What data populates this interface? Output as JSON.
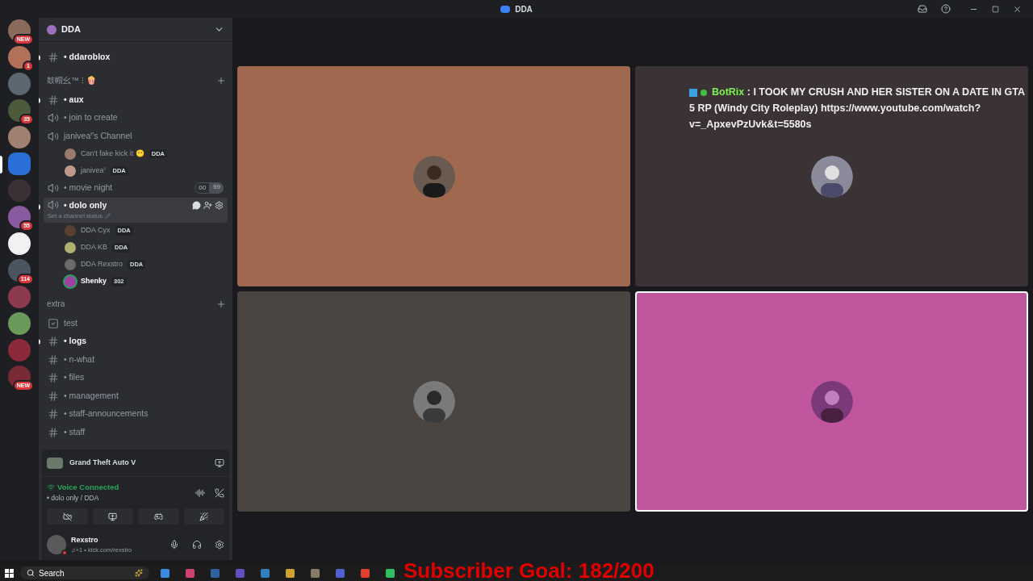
{
  "window": {
    "title": "DDA"
  },
  "servers": [
    {
      "kind": "avatar",
      "color": "#8a6a5a",
      "badge": "NEW",
      "selected": false
    },
    {
      "kind": "avatar",
      "color": "#b4715a",
      "badge": "1",
      "selected": false
    },
    {
      "kind": "avatar",
      "color": "#5a6670",
      "selected": false
    },
    {
      "kind": "avatar",
      "color": "#4a5a3a",
      "badge": "35",
      "selected": false
    },
    {
      "kind": "avatar",
      "color": "#a08070",
      "selected": false
    },
    {
      "kind": "avatar",
      "color": "#2a6fd6",
      "selected": true
    },
    {
      "kind": "avatar",
      "color": "#3a3035",
      "selected": false
    },
    {
      "kind": "avatar",
      "color": "#8a5aa0",
      "badge": "55",
      "selected": false
    },
    {
      "kind": "avatar",
      "color": "#f2f2f2",
      "selected": false
    },
    {
      "kind": "avatar",
      "color": "#4a5560",
      "badge": "114",
      "selected": false
    },
    {
      "kind": "avatar",
      "color": "#8a3a4a",
      "selected": false
    },
    {
      "kind": "avatar",
      "color": "#6a9a5a",
      "selected": false
    },
    {
      "kind": "avatar",
      "color": "#8a2a3a",
      "selected": false
    },
    {
      "kind": "avatar",
      "color": "#7a2a35",
      "badge": "NEW",
      "selected": false
    }
  ],
  "server": {
    "name": "DDA"
  },
  "channels": [
    {
      "kind": "text",
      "name": "• ddaroblox",
      "unread": true,
      "selected": false
    },
    {
      "kind": "category",
      "name": "鼓帽幺™ ⁝ 🍿"
    },
    {
      "kind": "text",
      "name": "• aux",
      "unread": true,
      "selected": false
    },
    {
      "kind": "voice",
      "name": "• join to create",
      "unread": false,
      "selected": false
    },
    {
      "kind": "voice",
      "name": "janiveaᑊ's Channel",
      "unread": false,
      "selected": false,
      "members": [
        {
          "name": "Can't fake kick it 😶",
          "tag": "DDA",
          "speaking": false,
          "color": "#9a7a6a"
        },
        {
          "name": "janiveaᑊ",
          "tag": "DDA",
          "speaking": false,
          "color": "#c09a8a"
        }
      ]
    },
    {
      "kind": "voice",
      "name": "• movie night",
      "unread": false,
      "selected": false,
      "counts": [
        "00",
        "99"
      ]
    },
    {
      "kind": "voice",
      "name": "• dolo only",
      "unread": true,
      "selected": true,
      "status": "Set a channel status",
      "members": [
        {
          "name": "DDA Cyx",
          "tag": "DDA",
          "speaking": false,
          "color": "#5a4030"
        },
        {
          "name": "DDA KB",
          "tag": "DDA",
          "speaking": false,
          "color": "#b0b070"
        },
        {
          "name": "DDA Rexstro",
          "tag": "DDA",
          "speaking": false,
          "color": "#6a6a6a"
        },
        {
          "name": "Shenky",
          "tag": "302",
          "speaking": true,
          "color": "#a040a0"
        }
      ]
    },
    {
      "kind": "category",
      "name": "extra"
    },
    {
      "kind": "forum",
      "name": "test",
      "unread": false,
      "selected": false
    },
    {
      "kind": "text",
      "name": "• logs",
      "unread": true,
      "selected": false
    },
    {
      "kind": "text",
      "name": "• n-what",
      "unread": false,
      "selected": false
    },
    {
      "kind": "text",
      "name": "• files",
      "unread": false,
      "selected": false
    },
    {
      "kind": "text",
      "name": "• management",
      "unread": false,
      "selected": false
    },
    {
      "kind": "text",
      "name": "• staff-announcements",
      "unread": false,
      "selected": false
    },
    {
      "kind": "text",
      "name": "• staff",
      "unread": false,
      "selected": false
    }
  ],
  "activity": {
    "game": "Grand Theft Auto V"
  },
  "voice": {
    "status": "Voice Connected",
    "channel": "• dolo only / DDA"
  },
  "user": {
    "name": "Rexstro",
    "status": "♫+1 • kick.com/rexstro"
  },
  "tiles": [
    {
      "color": "#a0694f",
      "speaking": false
    },
    {
      "color": "#3a3234",
      "speaking": false,
      "chat": {
        "author": "BotRix",
        "text": ": I TOOK MY CRUSH AND HER SISTER ON A DATE IN GTA 5 RP (Windy City Roleplay) https://www.youtube.com/watch?v=_ApxevPzUvk&t=5580s"
      }
    },
    {
      "color": "#4a4541",
      "speaking": false
    },
    {
      "color": "#c0569e",
      "speaking": true
    }
  ],
  "taskbar": {
    "search": "Search"
  },
  "overlay": {
    "goal": "Subscriber Goal: 182/200"
  }
}
